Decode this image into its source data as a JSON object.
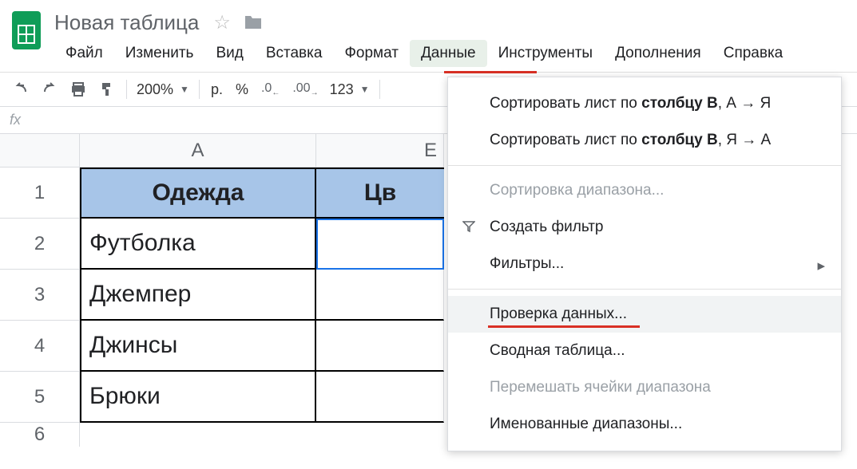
{
  "header": {
    "doc_title": "Новая таблица",
    "menus": [
      "Файл",
      "Изменить",
      "Вид",
      "Вставка",
      "Формат",
      "Данные",
      "Инструменты",
      "Дополнения",
      "Справка"
    ],
    "active_menu_index": 5
  },
  "toolbar": {
    "zoom": "200%",
    "currency": "р.",
    "percent": "%",
    "dec_dec": ".0",
    "inc_dec": ".00",
    "format_more": "123"
  },
  "fx": {
    "label": "fx"
  },
  "sheet": {
    "columns": [
      "A",
      "B"
    ],
    "row_numbers": [
      "1",
      "2",
      "3",
      "4",
      "5",
      "6"
    ],
    "header_row": {
      "a": "Одежда",
      "b_partial": "Цв"
    },
    "data": [
      {
        "a": "Футболка"
      },
      {
        "a": "Джемпер"
      },
      {
        "a": "Джинсы"
      },
      {
        "a": "Брюки"
      }
    ]
  },
  "dropdown": {
    "sort_asc_prefix": "Сортировать лист по ",
    "sort_col": "столбцу B",
    "sort_asc_suffix": ", А → Я",
    "sort_desc_prefix": "Сортировать лист по ",
    "sort_desc_suffix": ", Я → А",
    "sort_range": "Сортировка диапазона...",
    "create_filter": "Создать фильтр",
    "filters": "Фильтры...",
    "data_validation": "Проверка данных...",
    "pivot_table": "Сводная таблица...",
    "shuffle_range": "Перемешать ячейки диапазона",
    "named_ranges": "Именованные диапазоны..."
  }
}
